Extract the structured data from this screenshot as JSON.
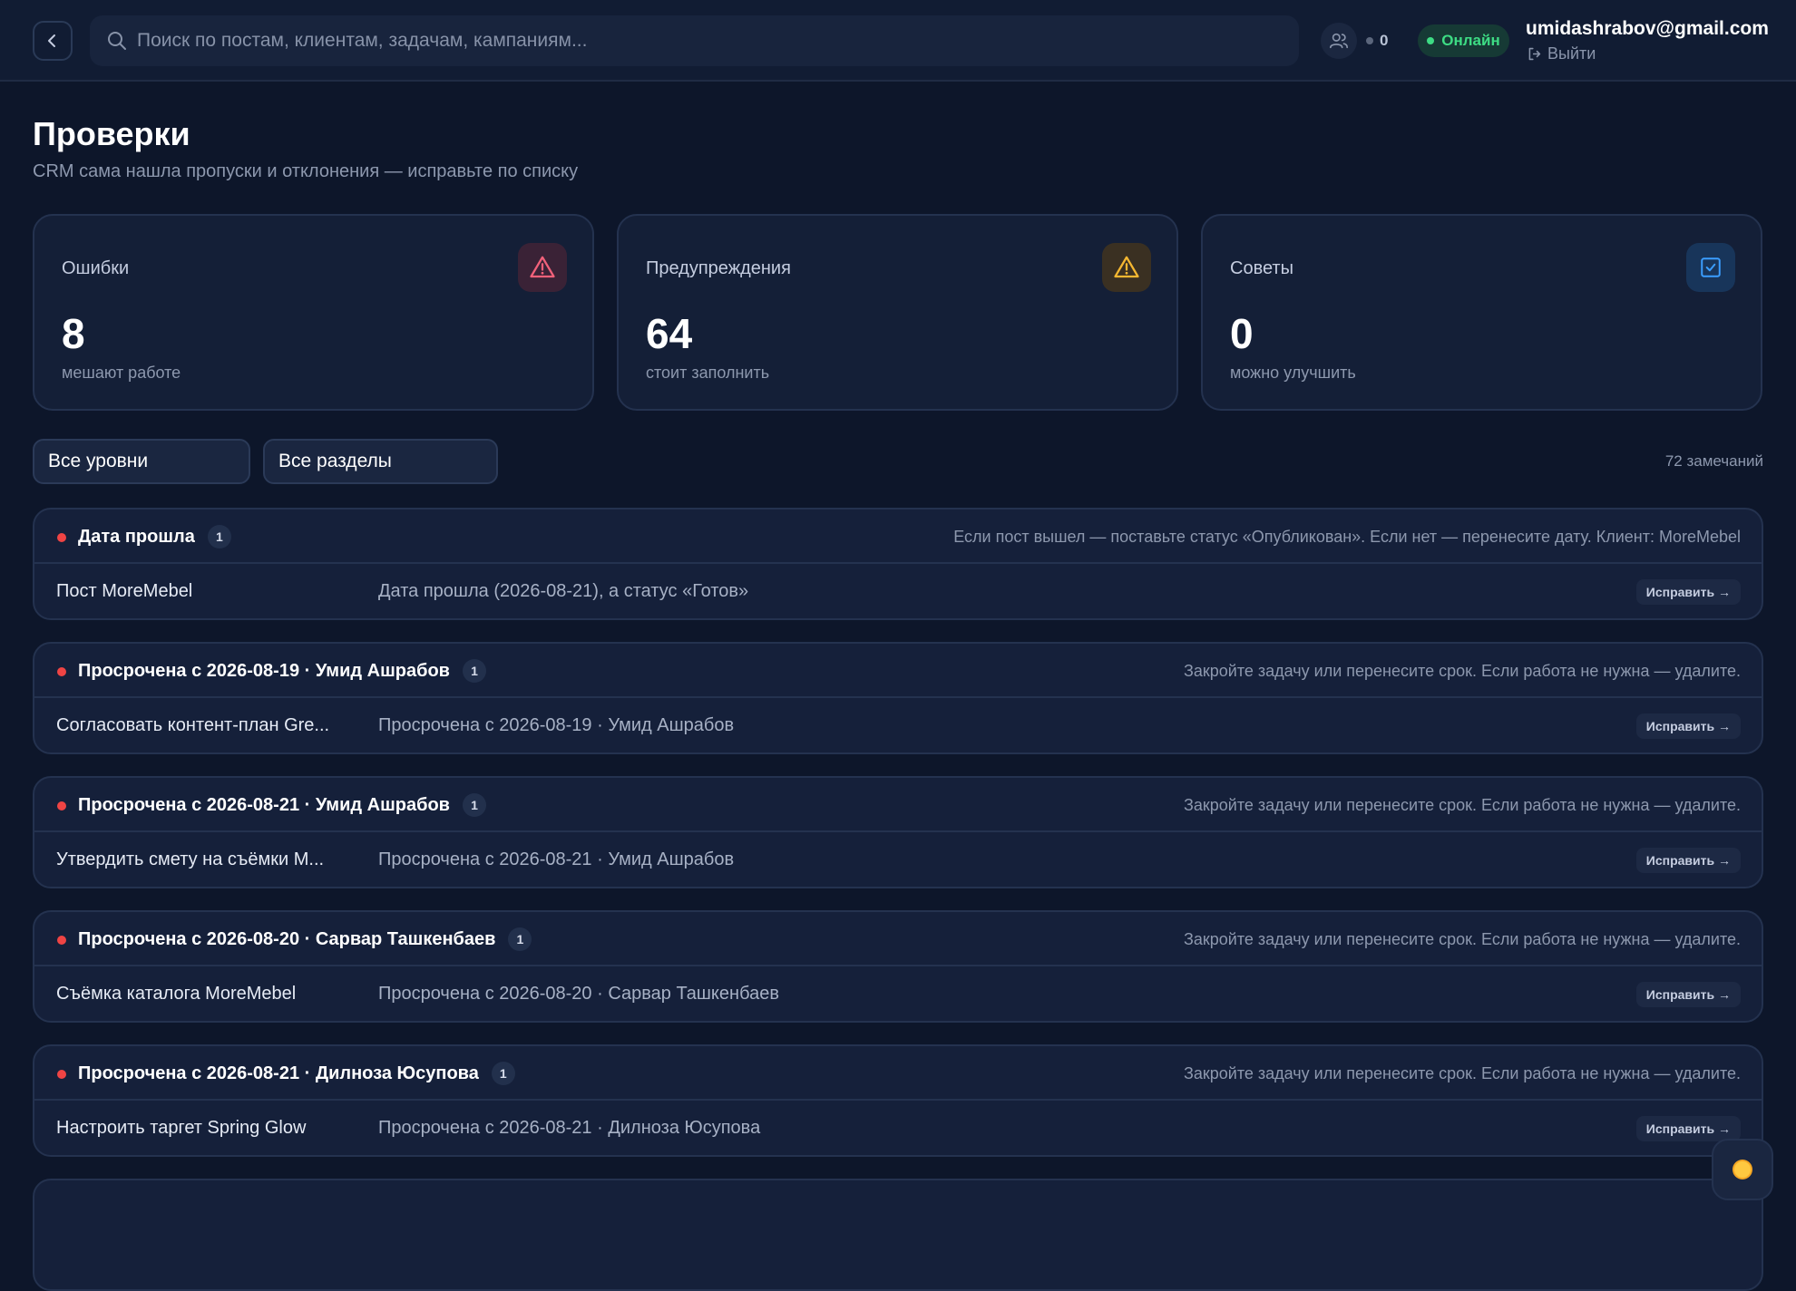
{
  "header": {
    "search_placeholder": "Поиск по постам, клиентам, задачам, кампаниям...",
    "online_users_count": "0",
    "online_label": "Онлайн",
    "user_email": "umidashrabov@gmail.com",
    "logout_label": "Выйти"
  },
  "page": {
    "title": "Проверки",
    "subtitle": "CRM сама нашла пропуски и отклонения — исправьте по списку"
  },
  "stats": [
    {
      "label": "Ошибки",
      "value": "8",
      "caption": "мешают работе",
      "icon": "alert-triangle-icon",
      "accent": "#f2617a"
    },
    {
      "label": "Предупреждения",
      "value": "64",
      "caption": "стоит заполнить",
      "icon": "warning-triangle-icon",
      "accent": "#f5b731"
    },
    {
      "label": "Советы",
      "value": "0",
      "caption": "можно улучшить",
      "icon": "check-square-icon",
      "accent": "#3b9eff"
    }
  ],
  "filters": {
    "level": "Все уровни",
    "section": "Все разделы",
    "total": "72 замечаний"
  },
  "issues": [
    {
      "title": "Дата прошла",
      "count": "1",
      "hint": "Если пост вышел — поставьте статус «Опубликован». Если нет — перенесите дату. Клиент: MoreMebel",
      "item": "Пост MoreMebel",
      "desc": "Дата прошла (2026-08-21), а статус «Готов»",
      "action": "Исправить →",
      "severity_color": "#ef4444"
    },
    {
      "title": "Просрочена с 2026-08-19 · Умид Ашрабов",
      "count": "1",
      "hint": "Закройте задачу или перенесите срок. Если работа не нужна — удалите.",
      "item": "Согласовать контент-план Gre...",
      "desc": "Просрочена с 2026-08-19 · Умид Ашрабов",
      "action": "Исправить →",
      "severity_color": "#ef4444"
    },
    {
      "title": "Просрочена с 2026-08-21 · Умид Ашрабов",
      "count": "1",
      "hint": "Закройте задачу или перенесите срок. Если работа не нужна — удалите.",
      "item": "Утвердить смету на съёмки M...",
      "desc": "Просрочена с 2026-08-21 · Умид Ашрабов",
      "action": "Исправить →",
      "severity_color": "#ef4444"
    },
    {
      "title": "Просрочена с 2026-08-20 · Сарвар Ташкенбаев",
      "count": "1",
      "hint": "Закройте задачу или перенесите срок. Если работа не нужна — удалите.",
      "item": "Съёмка каталога MoreMebel",
      "desc": "Просрочена с 2026-08-20 · Сарвар Ташкенбаев",
      "action": "Исправить →",
      "severity_color": "#ef4444"
    },
    {
      "title": "Просрочена с 2026-08-21 · Дилноза Юсупова",
      "count": "1",
      "hint": "Закройте задачу или перенесите срок. Если работа не нужна — удалите.",
      "item": "Настроить таргет Spring Glow",
      "desc": "Просрочена с 2026-08-21 · Дилноза Юсупова",
      "action": "Исправить →",
      "severity_color": "#ef4444"
    }
  ],
  "theme_toggle_icon": "sun-icon"
}
